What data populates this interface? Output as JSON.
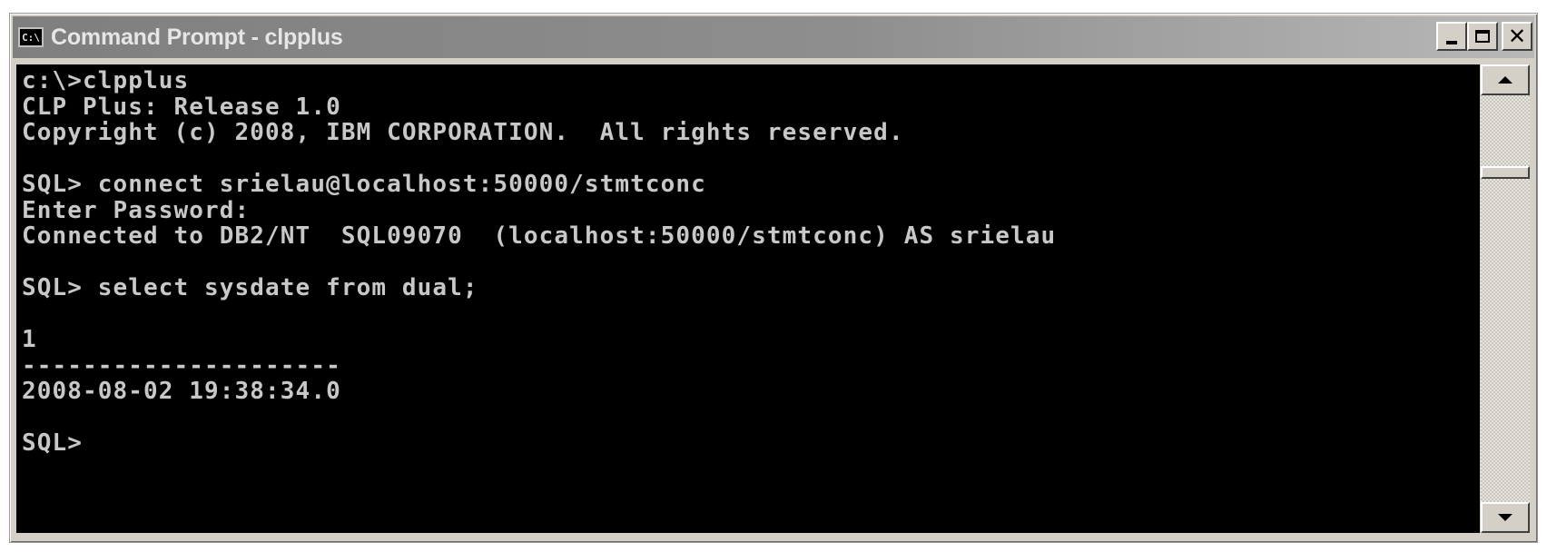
{
  "window": {
    "title": "Command Prompt - clpplus",
    "icon": "cmd-icon",
    "icon_label": "C:\\"
  },
  "controls": {
    "minimize_icon": "minimize-icon",
    "maximize_icon": "maximize-icon",
    "close_icon": "close-icon",
    "close_glyph": "✕"
  },
  "console": {
    "lines": [
      "c:\\>clpplus",
      "CLP Plus: Release 1.0",
      "Copyright (c) 2008, IBM CORPORATION.  All rights reserved.",
      "",
      "SQL> connect srielau@localhost:50000/stmtconc",
      "Enter Password:",
      "Connected to DB2/NT  SQL09070  (localhost:50000/stmtconc) AS srielau",
      "",
      "SQL> select sysdate from dual;",
      "",
      "1",
      "---------------------",
      "2008-08-02 19:38:34.0",
      "",
      "SQL>"
    ],
    "text_color": "#c8c8c8",
    "background": "#000000"
  },
  "scrollbar": {
    "up_icon": "arrow-up-icon",
    "down_icon": "arrow-down-icon"
  }
}
